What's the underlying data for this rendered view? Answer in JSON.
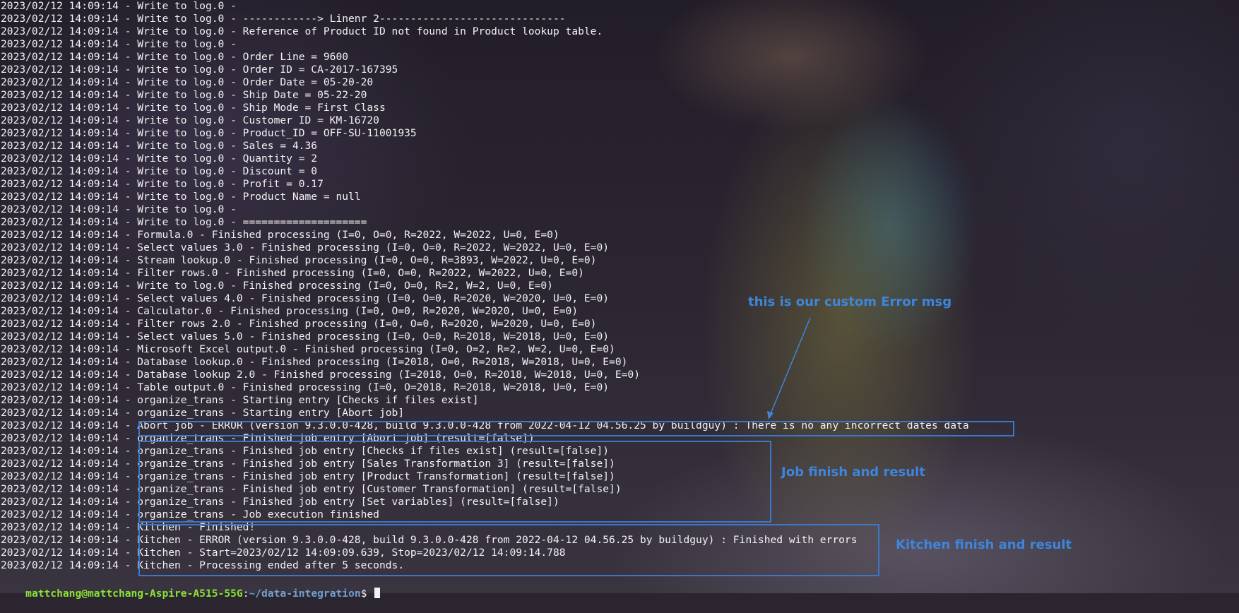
{
  "terminal": {
    "log_lines": [
      "2023/02/12 14:09:14 - Write to log.0 - ",
      "2023/02/12 14:09:14 - Write to log.0 - ------------> Linenr 2------------------------------",
      "2023/02/12 14:09:14 - Write to log.0 - Reference of Product ID not found in Product lookup table.",
      "2023/02/12 14:09:14 - Write to log.0 - ",
      "2023/02/12 14:09:14 - Write to log.0 - Order Line = 9600",
      "2023/02/12 14:09:14 - Write to log.0 - Order ID = CA-2017-167395",
      "2023/02/12 14:09:14 - Write to log.0 - Order Date = 05-20-20",
      "2023/02/12 14:09:14 - Write to log.0 - Ship Date = 05-22-20",
      "2023/02/12 14:09:14 - Write to log.0 - Ship Mode = First Class",
      "2023/02/12 14:09:14 - Write to log.0 - Customer ID = KM-16720",
      "2023/02/12 14:09:14 - Write to log.0 - Product_ID = OFF-SU-11001935",
      "2023/02/12 14:09:14 - Write to log.0 - Sales = 4.36",
      "2023/02/12 14:09:14 - Write to log.0 - Quantity = 2",
      "2023/02/12 14:09:14 - Write to log.0 - Discount = 0",
      "2023/02/12 14:09:14 - Write to log.0 - Profit = 0.17",
      "2023/02/12 14:09:14 - Write to log.0 - Product Name = null",
      "2023/02/12 14:09:14 - Write to log.0 - ",
      "2023/02/12 14:09:14 - Write to log.0 - ====================",
      "2023/02/12 14:09:14 - Formula.0 - Finished processing (I=0, O=0, R=2022, W=2022, U=0, E=0)",
      "2023/02/12 14:09:14 - Select values 3.0 - Finished processing (I=0, O=0, R=2022, W=2022, U=0, E=0)",
      "2023/02/12 14:09:14 - Stream lookup.0 - Finished processing (I=0, O=0, R=3893, W=2022, U=0, E=0)",
      "2023/02/12 14:09:14 - Filter rows.0 - Finished processing (I=0, O=0, R=2022, W=2022, U=0, E=0)",
      "2023/02/12 14:09:14 - Write to log.0 - Finished processing (I=0, O=0, R=2, W=2, U=0, E=0)",
      "2023/02/12 14:09:14 - Select values 4.0 - Finished processing (I=0, O=0, R=2020, W=2020, U=0, E=0)",
      "2023/02/12 14:09:14 - Calculator.0 - Finished processing (I=0, O=0, R=2020, W=2020, U=0, E=0)",
      "2023/02/12 14:09:14 - Filter rows 2.0 - Finished processing (I=0, O=0, R=2020, W=2020, U=0, E=0)",
      "2023/02/12 14:09:14 - Select values 5.0 - Finished processing (I=0, O=0, R=2018, W=2018, U=0, E=0)",
      "2023/02/12 14:09:14 - Microsoft Excel output.0 - Finished processing (I=0, O=2, R=2, W=2, U=0, E=0)",
      "2023/02/12 14:09:14 - Database lookup.0 - Finished processing (I=2018, O=0, R=2018, W=2018, U=0, E=0)",
      "2023/02/12 14:09:14 - Database lookup 2.0 - Finished processing (I=2018, O=0, R=2018, W=2018, U=0, E=0)",
      "2023/02/12 14:09:14 - Table output.0 - Finished processing (I=0, O=2018, R=2018, W=2018, U=0, E=0)",
      "2023/02/12 14:09:14 - organize_trans - Starting entry [Checks if files exist]",
      "2023/02/12 14:09:14 - organize_trans - Starting entry [Abort job]",
      "2023/02/12 14:09:14 - Abort job - ERROR (version 9.3.0.0-428, build 9.3.0.0-428 from 2022-04-12 04.56.25 by buildguy) : There is no any incorrect dates data",
      "2023/02/12 14:09:14 - organize_trans - Finished job entry [Abort job] (result=[false])",
      "2023/02/12 14:09:14 - organize_trans - Finished job entry [Checks if files exist] (result=[false])",
      "2023/02/12 14:09:14 - organize_trans - Finished job entry [Sales Transformation 3] (result=[false])",
      "2023/02/12 14:09:14 - organize_trans - Finished job entry [Product Transformation] (result=[false])",
      "2023/02/12 14:09:14 - organize_trans - Finished job entry [Customer Transformation] (result=[false])",
      "2023/02/12 14:09:14 - organize_trans - Finished job entry [Set variables] (result=[false])",
      "2023/02/12 14:09:14 - organize_trans - Job execution finished",
      "2023/02/12 14:09:14 - Kitchen - Finished!",
      "2023/02/12 14:09:14 - Kitchen - ERROR (version 9.3.0.0-428, build 9.3.0.0-428 from 2022-04-12 04.56.25 by buildguy) : Finished with errors",
      "2023/02/12 14:09:14 - Kitchen - Start=2023/02/12 14:09:09.639, Stop=2023/02/12 14:09:14.788",
      "2023/02/12 14:09:14 - Kitchen - Processing ended after 5 seconds."
    ],
    "prompt": {
      "user_host": "mattchang@mattchang-Aspire-A515-55G",
      "separator": ":",
      "path": "~/data-integration",
      "symbol": "$ "
    }
  },
  "annotations": {
    "error_note": "this is our custom Error msg",
    "job_note": "Job finish and result",
    "kitchen_note": "Kitchen finish and result",
    "accent_color": "#3b78c8"
  }
}
